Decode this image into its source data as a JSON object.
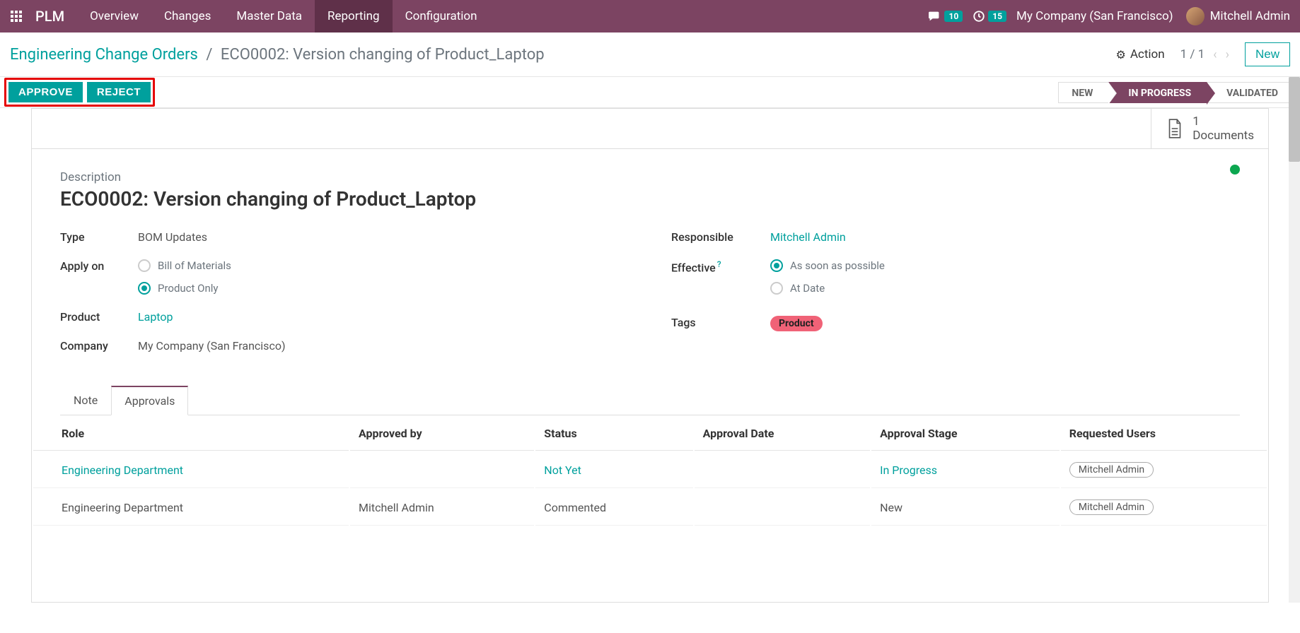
{
  "topbar": {
    "brand": "PLM",
    "nav": [
      "Overview",
      "Changes",
      "Master Data",
      "Reporting",
      "Configuration"
    ],
    "active_nav_index": 3,
    "chat_badge": "10",
    "activity_badge": "15",
    "company": "My Company (San Francisco)",
    "user": "Mitchell Admin"
  },
  "breadcrumb": {
    "root": "Engineering Change Orders",
    "current": "ECO0002: Version changing of Product_Laptop",
    "action_label": "Action",
    "pager": "1 / 1",
    "new_label": "New"
  },
  "statusbar": {
    "approve": "APPROVE",
    "reject": "REJECT",
    "stages": [
      "NEW",
      "IN PROGRESS",
      "VALIDATED"
    ],
    "active_stage_index": 1
  },
  "doc_stat": {
    "count": "1",
    "label": "Documents"
  },
  "record": {
    "description_label": "Description",
    "title": "ECO0002: Version changing of Product_Laptop",
    "type_label": "Type",
    "type_value": "BOM Updates",
    "apply_on_label": "Apply on",
    "apply_on_options": [
      "Bill of Materials",
      "Product Only"
    ],
    "apply_on_selected_index": 1,
    "product_label": "Product",
    "product_value": "Laptop",
    "company_label": "Company",
    "company_value": "My Company (San Francisco)",
    "responsible_label": "Responsible",
    "responsible_value": "Mitchell Admin",
    "effective_label": "Effective",
    "effective_options": [
      "As soon as possible",
      "At Date"
    ],
    "effective_selected_index": 0,
    "tags_label": "Tags",
    "tags": [
      "Product"
    ]
  },
  "tabs": {
    "items": [
      "Note",
      "Approvals"
    ],
    "active_index": 1
  },
  "approvals": {
    "headers": [
      "Role",
      "Approved by",
      "Status",
      "Approval Date",
      "Approval Stage",
      "Requested Users"
    ],
    "rows": [
      {
        "role": "Engineering Department",
        "role_link": true,
        "approved_by": "",
        "status": "Not Yet",
        "status_link": true,
        "date": "",
        "stage": "In Progress",
        "stage_link": true,
        "user": "Mitchell Admin"
      },
      {
        "role": "Engineering Department",
        "role_link": false,
        "approved_by": "Mitchell Admin",
        "status": "Commented",
        "status_link": false,
        "date": "",
        "stage": "New",
        "stage_link": false,
        "user": "Mitchell Admin"
      }
    ]
  }
}
